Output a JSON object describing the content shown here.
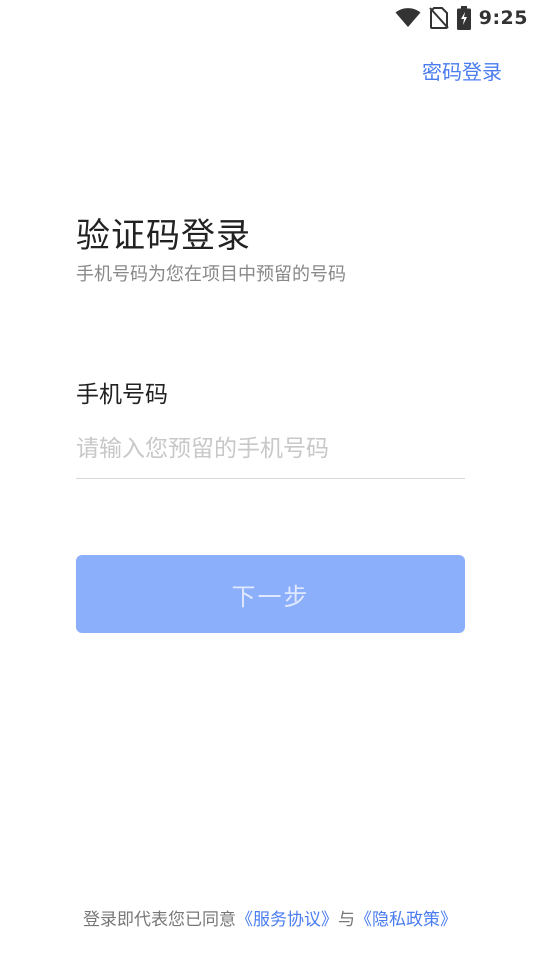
{
  "status_bar": {
    "time": "9:25",
    "icons": [
      "wifi-icon",
      "no-sim-icon",
      "battery-charging-icon"
    ]
  },
  "header": {
    "password_login_link": "密码登录"
  },
  "main": {
    "title": "验证码登录",
    "subtitle": "手机号码为您在项目中预留的号码",
    "phone_label": "手机号码",
    "phone_value": "",
    "phone_placeholder": "请输入您预留的手机号码",
    "next_button": "下一步"
  },
  "footer": {
    "prefix": "登录即代表您已同意",
    "service_agreement": "《服务协议》",
    "conjunction": "与",
    "privacy_policy": "《隐私政策》"
  },
  "colors": {
    "accent": "#4a7cf0",
    "button_disabled": "#8caffb",
    "text_primary": "#222222",
    "text_secondary": "#888888",
    "placeholder": "#c8c8c8"
  }
}
